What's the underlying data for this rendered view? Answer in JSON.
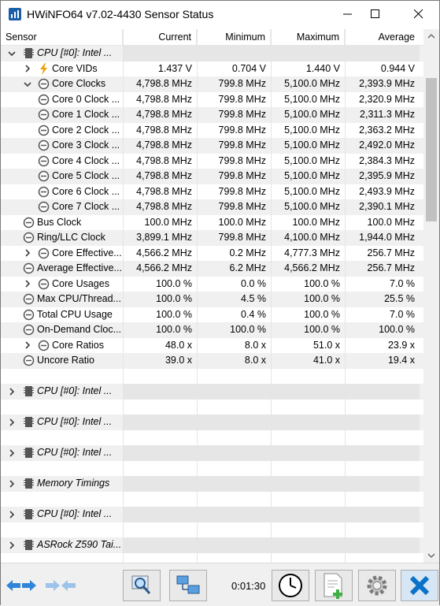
{
  "window": {
    "title": "HWiNFO64 v7.02-4430 Sensor Status"
  },
  "columns": {
    "sensor": "Sensor",
    "current": "Current",
    "minimum": "Minimum",
    "maximum": "Maximum",
    "average": "Average"
  },
  "rows": [
    {
      "label": "CPU [#0]: Intel ...",
      "kind": "group",
      "expanded": true,
      "icon": "chip-icon",
      "level": 0,
      "current": "",
      "minimum": "",
      "maximum": "",
      "average": ""
    },
    {
      "label": "Core VIDs",
      "kind": "sensor",
      "expandable": true,
      "expanded": false,
      "icon": "voltage-icon",
      "level": 1,
      "current": "1.437 V",
      "minimum": "0.704 V",
      "maximum": "1.440 V",
      "average": "0.944 V"
    },
    {
      "label": "Core Clocks",
      "kind": "sensor",
      "expandable": true,
      "expanded": true,
      "icon": "clock-icon",
      "level": 1,
      "current": "4,798.8 MHz",
      "minimum": "799.8 MHz",
      "maximum": "5,100.0 MHz",
      "average": "2,393.9 MHz"
    },
    {
      "label": "Core 0 Clock ...",
      "kind": "sensor",
      "icon": "clock-icon",
      "level": 2,
      "current": "4,798.8 MHz",
      "minimum": "799.8 MHz",
      "maximum": "5,100.0 MHz",
      "average": "2,320.9 MHz"
    },
    {
      "label": "Core 1 Clock ...",
      "kind": "sensor",
      "icon": "clock-icon",
      "level": 2,
      "current": "4,798.8 MHz",
      "minimum": "799.8 MHz",
      "maximum": "5,100.0 MHz",
      "average": "2,311.3 MHz"
    },
    {
      "label": "Core 2 Clock ...",
      "kind": "sensor",
      "icon": "clock-icon",
      "level": 2,
      "current": "4,798.8 MHz",
      "minimum": "799.8 MHz",
      "maximum": "5,100.0 MHz",
      "average": "2,363.2 MHz"
    },
    {
      "label": "Core 3 Clock ...",
      "kind": "sensor",
      "icon": "clock-icon",
      "level": 2,
      "current": "4,798.8 MHz",
      "minimum": "799.8 MHz",
      "maximum": "5,100.0 MHz",
      "average": "2,492.0 MHz"
    },
    {
      "label": "Core 4 Clock ...",
      "kind": "sensor",
      "icon": "clock-icon",
      "level": 2,
      "current": "4,798.8 MHz",
      "minimum": "799.8 MHz",
      "maximum": "5,100.0 MHz",
      "average": "2,384.3 MHz"
    },
    {
      "label": "Core 5 Clock ...",
      "kind": "sensor",
      "icon": "clock-icon",
      "level": 2,
      "current": "4,798.8 MHz",
      "minimum": "799.8 MHz",
      "maximum": "5,100.0 MHz",
      "average": "2,395.9 MHz"
    },
    {
      "label": "Core 6 Clock ...",
      "kind": "sensor",
      "icon": "clock-icon",
      "level": 2,
      "current": "4,798.8 MHz",
      "minimum": "799.8 MHz",
      "maximum": "5,100.0 MHz",
      "average": "2,493.9 MHz"
    },
    {
      "label": "Core 7 Clock ...",
      "kind": "sensor",
      "icon": "clock-icon",
      "level": 2,
      "current": "4,798.8 MHz",
      "minimum": "799.8 MHz",
      "maximum": "5,100.0 MHz",
      "average": "2,390.1 MHz"
    },
    {
      "label": "Bus Clock",
      "kind": "sensor",
      "icon": "clock-icon",
      "level": 1,
      "current": "100.0 MHz",
      "minimum": "100.0 MHz",
      "maximum": "100.0 MHz",
      "average": "100.0 MHz"
    },
    {
      "label": "Ring/LLC Clock",
      "kind": "sensor",
      "icon": "clock-icon",
      "level": 1,
      "current": "3,899.1 MHz",
      "minimum": "799.8 MHz",
      "maximum": "4,100.0 MHz",
      "average": "1,944.0 MHz"
    },
    {
      "label": "Core Effective...",
      "kind": "sensor",
      "expandable": true,
      "expanded": false,
      "icon": "clock-icon",
      "level": 1,
      "current": "4,566.2 MHz",
      "minimum": "0.2 MHz",
      "maximum": "4,777.3 MHz",
      "average": "256.7 MHz"
    },
    {
      "label": "Average Effective...",
      "kind": "sensor",
      "icon": "clock-icon",
      "level": 1,
      "current": "4,566.2 MHz",
      "minimum": "6.2 MHz",
      "maximum": "4,566.2 MHz",
      "average": "256.7 MHz"
    },
    {
      "label": "Core Usages",
      "kind": "sensor",
      "expandable": true,
      "expanded": false,
      "icon": "clock-icon",
      "level": 1,
      "current": "100.0 %",
      "minimum": "0.0 %",
      "maximum": "100.0 %",
      "average": "7.0 %"
    },
    {
      "label": "Max CPU/Thread...",
      "kind": "sensor",
      "icon": "clock-icon",
      "level": 1,
      "current": "100.0 %",
      "minimum": "4.5 %",
      "maximum": "100.0 %",
      "average": "25.5 %"
    },
    {
      "label": "Total CPU Usage",
      "kind": "sensor",
      "icon": "clock-icon",
      "level": 1,
      "current": "100.0 %",
      "minimum": "0.4 %",
      "maximum": "100.0 %",
      "average": "7.0 %"
    },
    {
      "label": "On-Demand Cloc...",
      "kind": "sensor",
      "icon": "clock-icon",
      "level": 1,
      "current": "100.0 %",
      "minimum": "100.0 %",
      "maximum": "100.0 %",
      "average": "100.0 %"
    },
    {
      "label": "Core Ratios",
      "kind": "sensor",
      "expandable": true,
      "expanded": false,
      "icon": "clock-icon",
      "level": 1,
      "current": "48.0 x",
      "minimum": "8.0 x",
      "maximum": "51.0 x",
      "average": "23.9 x"
    },
    {
      "label": "Uncore Ratio",
      "kind": "sensor",
      "icon": "clock-icon",
      "level": 1,
      "current": "39.0 x",
      "minimum": "8.0 x",
      "maximum": "41.0 x",
      "average": "19.4 x"
    },
    {
      "kind": "blank"
    },
    {
      "label": "CPU [#0]: Intel ...",
      "kind": "group",
      "expanded": false,
      "icon": "chip-icon",
      "level": 0,
      "current": "",
      "minimum": "",
      "maximum": "",
      "average": ""
    },
    {
      "kind": "blank"
    },
    {
      "label": "CPU [#0]: Intel ...",
      "kind": "group",
      "expanded": false,
      "icon": "chip-icon",
      "level": 0,
      "current": "",
      "minimum": "",
      "maximum": "",
      "average": ""
    },
    {
      "kind": "blank"
    },
    {
      "label": "CPU [#0]: Intel ...",
      "kind": "group",
      "expanded": false,
      "icon": "chip-icon",
      "level": 0,
      "current": "",
      "minimum": "",
      "maximum": "",
      "average": ""
    },
    {
      "kind": "blank"
    },
    {
      "label": "Memory Timings",
      "kind": "group",
      "expanded": false,
      "icon": "chip-icon",
      "level": 0,
      "current": "",
      "minimum": "",
      "maximum": "",
      "average": ""
    },
    {
      "kind": "blank"
    },
    {
      "label": "CPU [#0]: Intel ...",
      "kind": "group",
      "expanded": false,
      "icon": "chip-icon",
      "level": 0,
      "current": "",
      "minimum": "",
      "maximum": "",
      "average": ""
    },
    {
      "kind": "blank"
    },
    {
      "label": "ASRock Z590 Tai...",
      "kind": "group",
      "expanded": false,
      "icon": "chip-icon",
      "level": 0,
      "current": "",
      "minimum": "",
      "maximum": "",
      "average": ""
    }
  ],
  "toolbar": {
    "timer": "0:01:30"
  },
  "colors": {
    "accent": "#1e7fd6",
    "clock_icon": "#555555",
    "voltage_icon": "#f0a000",
    "close_button": "#0a72c8"
  }
}
